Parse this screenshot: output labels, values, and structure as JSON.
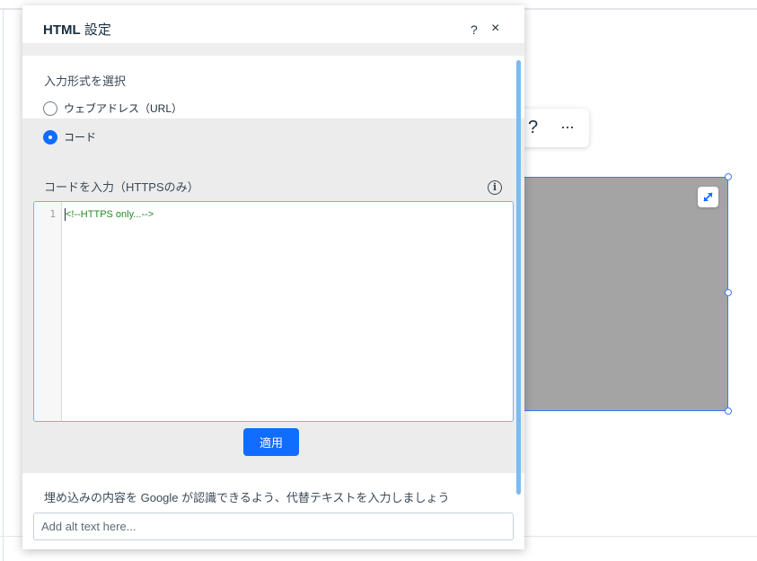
{
  "panel": {
    "title_bold": "HTML",
    "title_rest": " 設定",
    "help_label": "?",
    "close_label": "×"
  },
  "input_format": {
    "label": "入力形式を選択",
    "options": [
      {
        "label": "ウェブアドレス（URL）",
        "selected": false
      },
      {
        "label": "コード",
        "selected": true
      }
    ]
  },
  "code": {
    "label": "コードを入力（HTTPSのみ）",
    "info_icon": "info-icon",
    "lines": [
      {
        "number": "1",
        "text": "<!--HTTPS only...-->"
      }
    ],
    "apply_label": "適用"
  },
  "alt_text": {
    "label": "埋め込みの内容を Google が認識できるよう、代替テキストを入力しましょう",
    "placeholder": "Add alt text here...",
    "value": ""
  },
  "toolbar": {
    "help_label": "?",
    "more_label": "···"
  },
  "colors": {
    "accent": "#116dff",
    "element_fill": "#a4a4a4",
    "selection_border": "#3b7cf0",
    "code_text": "#228b22"
  }
}
